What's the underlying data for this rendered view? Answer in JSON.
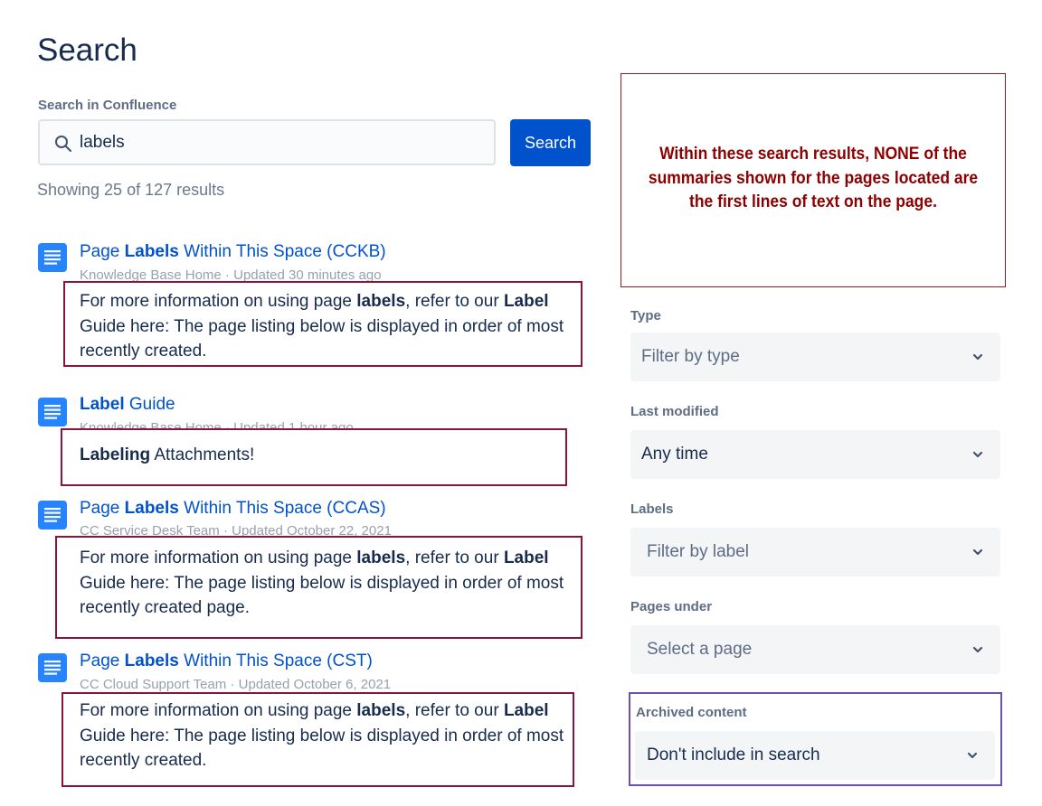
{
  "page": {
    "title": "Search"
  },
  "search": {
    "label": "Search in Confluence",
    "value": "labels",
    "button_label": "Search",
    "results_count": "Showing 25 of 127 results"
  },
  "results": [
    {
      "title_pre": "Page ",
      "title_bold": "Labels",
      "title_post": " Within This Space (CCKB)",
      "space": "Knowledge Base Home",
      "updated": "Updated 30 minutes ago",
      "summary_pre": "For more information on using page ",
      "summary_b1": "labels",
      "summary_mid": ", refer to our ",
      "summary_b2": "Label",
      "summary_post": " Guide here: The page listing below is displayed in order of most recently created."
    },
    {
      "title_pre": "",
      "title_bold": "Label",
      "title_post": " Guide",
      "space": "Knowledge Base Home",
      "updated": "Updated 1 hour ago",
      "summary_pre": "",
      "summary_b1": "Labeling",
      "summary_mid": " Attachments!",
      "summary_b2": "",
      "summary_post": ""
    },
    {
      "title_pre": "Page ",
      "title_bold": "Labels",
      "title_post": " Within This Space (CCAS)",
      "space": "CC Service Desk Team",
      "updated": "Updated October 22, 2021",
      "summary_pre": "For more information on using page ",
      "summary_b1": "labels",
      "summary_mid": ", refer to our ",
      "summary_b2": "Label",
      "summary_post": " Guide here: The page listing below is displayed in order of most recently created page."
    },
    {
      "title_pre": "Page ",
      "title_bold": "Labels",
      "title_post": " Within This Space (CST)",
      "space": "CC Cloud Support Team",
      "updated": "Updated October 6, 2021",
      "summary_pre": "For more information on using page ",
      "summary_b1": "labels",
      "summary_mid": ", refer to our ",
      "summary_b2": "Label",
      "summary_post": " Guide here: The page listing below is displayed in order of most recently created."
    }
  ],
  "meta_separator": " · ",
  "annotation": {
    "text": "Within these search results, NONE of the summaries shown for the pages located are the first lines of text on the page."
  },
  "filters": {
    "type": {
      "label": "Type",
      "value": "Filter by type"
    },
    "last_modified": {
      "label": "Last modified",
      "value": "Any time"
    },
    "labels": {
      "label": "Labels",
      "value": "Filter by label"
    },
    "pages_under": {
      "label": "Pages under",
      "value": "Select a page"
    },
    "archived": {
      "label": "Archived content",
      "value": "Don't include in search"
    }
  },
  "colors": {
    "primary": "#0052CC",
    "text": "#172B4D",
    "annotation_red": "#8B0000",
    "highlight_box": "#8B1538",
    "archived_box": "#6B4FBB"
  },
  "icons": {
    "search": "search-icon",
    "page": "page-icon",
    "chevron": "chevron-down-icon"
  }
}
